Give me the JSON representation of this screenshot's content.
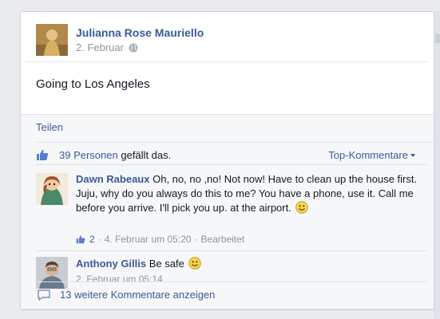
{
  "post": {
    "author": "Julianna Rose Mauriello",
    "date": "2. Februar",
    "text": "Going to Los Angeles"
  },
  "actions": {
    "share_label": "Teilen"
  },
  "likes": {
    "count_link": "39 Personen",
    "suffix": "gefällt das.",
    "sort_label": "Top-Kommentare"
  },
  "comments": [
    {
      "author": "Dawn Rabeaux",
      "text": "Oh, no, no ,no! Not now! Have to clean up the house first. Juju, why do you always do this to me? You have a phone, use it. Call me before you arrive. I'll pick you up. at the airport.",
      "like_count": "2",
      "time": "4. Februar um 05:20",
      "edited": "Bearbeitet",
      "separator": "·"
    },
    {
      "author": "Anthony Gillis",
      "text": "Be safe",
      "time": "2. Februar um 05:14"
    }
  ],
  "more_comments": "13 weitere Kommentare anzeigen",
  "colors": {
    "link": "#3b5998",
    "muted": "#90949c",
    "background": "#e9ebee"
  }
}
